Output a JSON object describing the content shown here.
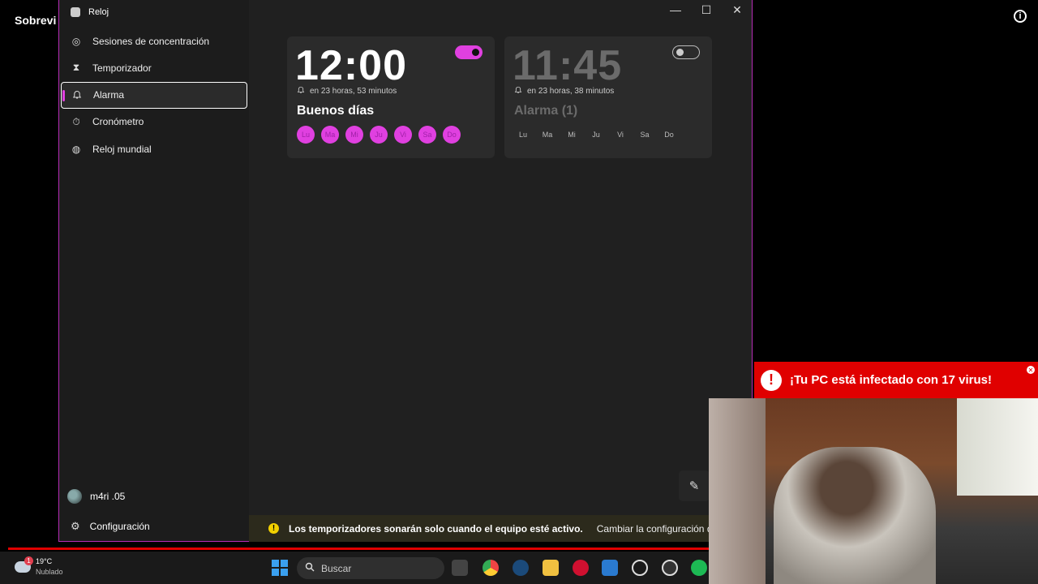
{
  "video": {
    "title": "Sobrevi"
  },
  "window": {
    "title": "Reloj",
    "controls": {
      "minimize": "—",
      "maximize": "☐",
      "close": "✕"
    }
  },
  "sidebar": {
    "items": [
      {
        "label": "Sesiones de concentración",
        "icon": "focus-icon"
      },
      {
        "label": "Temporizador",
        "icon": "hourglass-icon"
      },
      {
        "label": "Alarma",
        "icon": "bell-icon",
        "active": true
      },
      {
        "label": "Cronómetro",
        "icon": "stopwatch-icon"
      },
      {
        "label": "Reloj mundial",
        "icon": "globe-icon"
      }
    ],
    "user": "m4ri .05",
    "settings": "Configuración"
  },
  "alarms": [
    {
      "time": "12:00",
      "remaining": "en 23 horas, 53 minutos",
      "name": "Buenos días",
      "enabled": true,
      "days": [
        "Lu",
        "Ma",
        "Mi",
        "Ju",
        "Vi",
        "Sa",
        "Do"
      ]
    },
    {
      "time": "11:45",
      "remaining": "en 23 horas, 38 minutos",
      "name": "Alarma (1)",
      "enabled": false,
      "days": [
        "Lu",
        "Ma",
        "Mi",
        "Ju",
        "Vi",
        "Sa",
        "Do"
      ]
    }
  ],
  "notice": {
    "message": "Los temporizadores sonarán solo cuando el equipo esté activo.",
    "link": "Cambiar la configuración de ener"
  },
  "virus_popup": {
    "text": "¡Tu PC está infectado con 17 virus!"
  },
  "taskbar": {
    "weather_temp": "19°C",
    "weather_condition": "Nublado",
    "weather_badge": "1",
    "search_placeholder": "Buscar"
  },
  "colors": {
    "accent": "#e040e0",
    "window_border": "#b42cb4",
    "virus_red": "#e00000",
    "notice_warn": "#f2d000"
  }
}
